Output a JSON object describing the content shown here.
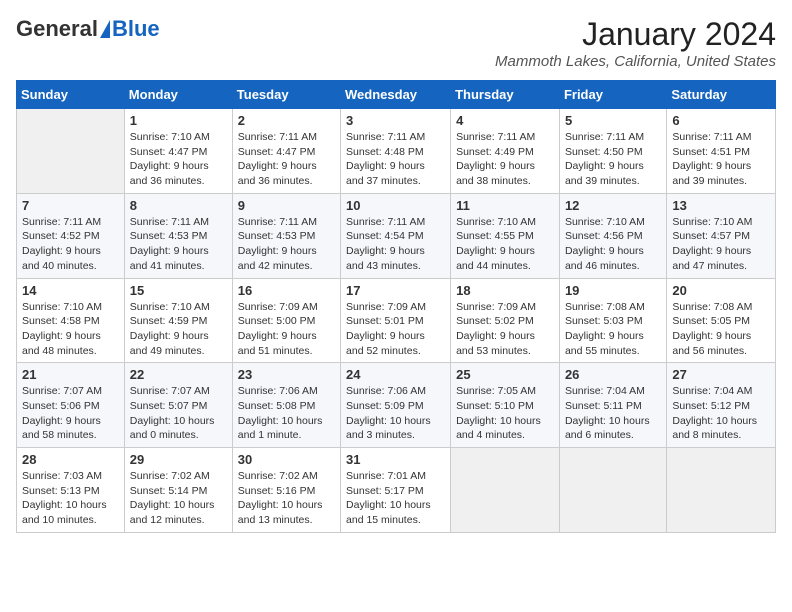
{
  "header": {
    "logo_general": "General",
    "logo_blue": "Blue",
    "month_title": "January 2024",
    "location": "Mammoth Lakes, California, United States"
  },
  "days_of_week": [
    "Sunday",
    "Monday",
    "Tuesday",
    "Wednesday",
    "Thursday",
    "Friday",
    "Saturday"
  ],
  "weeks": [
    [
      {
        "day": "",
        "info": ""
      },
      {
        "day": "1",
        "info": "Sunrise: 7:10 AM\nSunset: 4:47 PM\nDaylight: 9 hours\nand 36 minutes."
      },
      {
        "day": "2",
        "info": "Sunrise: 7:11 AM\nSunset: 4:47 PM\nDaylight: 9 hours\nand 36 minutes."
      },
      {
        "day": "3",
        "info": "Sunrise: 7:11 AM\nSunset: 4:48 PM\nDaylight: 9 hours\nand 37 minutes."
      },
      {
        "day": "4",
        "info": "Sunrise: 7:11 AM\nSunset: 4:49 PM\nDaylight: 9 hours\nand 38 minutes."
      },
      {
        "day": "5",
        "info": "Sunrise: 7:11 AM\nSunset: 4:50 PM\nDaylight: 9 hours\nand 39 minutes."
      },
      {
        "day": "6",
        "info": "Sunrise: 7:11 AM\nSunset: 4:51 PM\nDaylight: 9 hours\nand 39 minutes."
      }
    ],
    [
      {
        "day": "7",
        "info": "Sunrise: 7:11 AM\nSunset: 4:52 PM\nDaylight: 9 hours\nand 40 minutes."
      },
      {
        "day": "8",
        "info": "Sunrise: 7:11 AM\nSunset: 4:53 PM\nDaylight: 9 hours\nand 41 minutes."
      },
      {
        "day": "9",
        "info": "Sunrise: 7:11 AM\nSunset: 4:53 PM\nDaylight: 9 hours\nand 42 minutes."
      },
      {
        "day": "10",
        "info": "Sunrise: 7:11 AM\nSunset: 4:54 PM\nDaylight: 9 hours\nand 43 minutes."
      },
      {
        "day": "11",
        "info": "Sunrise: 7:10 AM\nSunset: 4:55 PM\nDaylight: 9 hours\nand 44 minutes."
      },
      {
        "day": "12",
        "info": "Sunrise: 7:10 AM\nSunset: 4:56 PM\nDaylight: 9 hours\nand 46 minutes."
      },
      {
        "day": "13",
        "info": "Sunrise: 7:10 AM\nSunset: 4:57 PM\nDaylight: 9 hours\nand 47 minutes."
      }
    ],
    [
      {
        "day": "14",
        "info": "Sunrise: 7:10 AM\nSunset: 4:58 PM\nDaylight: 9 hours\nand 48 minutes."
      },
      {
        "day": "15",
        "info": "Sunrise: 7:10 AM\nSunset: 4:59 PM\nDaylight: 9 hours\nand 49 minutes."
      },
      {
        "day": "16",
        "info": "Sunrise: 7:09 AM\nSunset: 5:00 PM\nDaylight: 9 hours\nand 51 minutes."
      },
      {
        "day": "17",
        "info": "Sunrise: 7:09 AM\nSunset: 5:01 PM\nDaylight: 9 hours\nand 52 minutes."
      },
      {
        "day": "18",
        "info": "Sunrise: 7:09 AM\nSunset: 5:02 PM\nDaylight: 9 hours\nand 53 minutes."
      },
      {
        "day": "19",
        "info": "Sunrise: 7:08 AM\nSunset: 5:03 PM\nDaylight: 9 hours\nand 55 minutes."
      },
      {
        "day": "20",
        "info": "Sunrise: 7:08 AM\nSunset: 5:05 PM\nDaylight: 9 hours\nand 56 minutes."
      }
    ],
    [
      {
        "day": "21",
        "info": "Sunrise: 7:07 AM\nSunset: 5:06 PM\nDaylight: 9 hours\nand 58 minutes."
      },
      {
        "day": "22",
        "info": "Sunrise: 7:07 AM\nSunset: 5:07 PM\nDaylight: 10 hours\nand 0 minutes."
      },
      {
        "day": "23",
        "info": "Sunrise: 7:06 AM\nSunset: 5:08 PM\nDaylight: 10 hours\nand 1 minute."
      },
      {
        "day": "24",
        "info": "Sunrise: 7:06 AM\nSunset: 5:09 PM\nDaylight: 10 hours\nand 3 minutes."
      },
      {
        "day": "25",
        "info": "Sunrise: 7:05 AM\nSunset: 5:10 PM\nDaylight: 10 hours\nand 4 minutes."
      },
      {
        "day": "26",
        "info": "Sunrise: 7:04 AM\nSunset: 5:11 PM\nDaylight: 10 hours\nand 6 minutes."
      },
      {
        "day": "27",
        "info": "Sunrise: 7:04 AM\nSunset: 5:12 PM\nDaylight: 10 hours\nand 8 minutes."
      }
    ],
    [
      {
        "day": "28",
        "info": "Sunrise: 7:03 AM\nSunset: 5:13 PM\nDaylight: 10 hours\nand 10 minutes."
      },
      {
        "day": "29",
        "info": "Sunrise: 7:02 AM\nSunset: 5:14 PM\nDaylight: 10 hours\nand 12 minutes."
      },
      {
        "day": "30",
        "info": "Sunrise: 7:02 AM\nSunset: 5:16 PM\nDaylight: 10 hours\nand 13 minutes."
      },
      {
        "day": "31",
        "info": "Sunrise: 7:01 AM\nSunset: 5:17 PM\nDaylight: 10 hours\nand 15 minutes."
      },
      {
        "day": "",
        "info": ""
      },
      {
        "day": "",
        "info": ""
      },
      {
        "day": "",
        "info": ""
      }
    ]
  ]
}
